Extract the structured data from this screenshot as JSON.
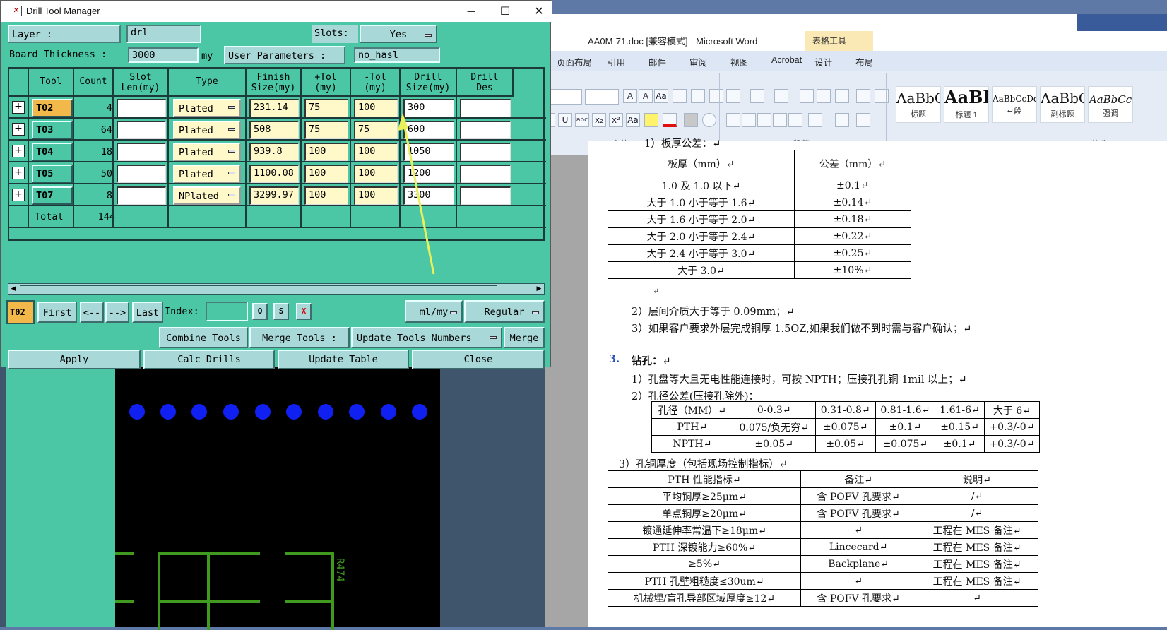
{
  "word": {
    "title": "AA0M-71.doc [兼容模式] - Microsoft Word",
    "table_tools": "表格工具",
    "tabs": [
      "页面布局",
      "引用",
      "邮件",
      "审阅",
      "视图",
      "Acrobat",
      "设计",
      "布局"
    ],
    "group_labels": [
      "字体",
      "段落",
      "样式"
    ],
    "styles": [
      {
        "sample": "AaBbC",
        "name": "标题"
      },
      {
        "sample": "AaBl",
        "name": "标题 1"
      },
      {
        "sample": "AaBbCcDd",
        "name": "↵段"
      },
      {
        "sample": "AaBbC",
        "name": "副标题"
      },
      {
        "sample": "AaBbCc",
        "name": "强调"
      }
    ],
    "ribbon_glyphs": [
      "A",
      "A",
      "Aa",
      "abc",
      "x₂",
      "x²",
      "Aa",
      "U",
      "I"
    ],
    "doc": {
      "heading_cut": "1）板厚公差：↵",
      "thickness_table": {
        "headers": [
          "板厚（mm）↵",
          "公差（mm）↵"
        ],
        "rows": [
          [
            "1.0 及 1.0 以下↵",
            "±0.1↵"
          ],
          [
            "大于 1.0 小于等于 1.6↵",
            "±0.14↵"
          ],
          [
            "大于 1.6 小于等于 2.0↵",
            "±0.18↵"
          ],
          [
            "大于 2.0 小于等于 2.4↵",
            "±0.22↵"
          ],
          [
            "大于 2.4 小于等于 3.0↵",
            "±0.25↵"
          ],
          [
            "大于 3.0↵",
            "±10%↵"
          ]
        ]
      },
      "empty_mark": "↵",
      "item2": "2）层间介质大于等于 0.09mm；↵",
      "item3": "3）如果客户要求外层完成铜厚 1.5OZ,如果我们做不到时需与客户确认；↵",
      "section3_number": "3.",
      "section3_title": "钻孔：↵",
      "drill1": "1）孔盘等大且无电性能连接时，可按 NPTH；压接孔孔铜 1mil 以上；↵",
      "drill2": "2）孔径公差(压接孔除外)：",
      "hole_table": {
        "rows": [
          [
            "孔径（MM）↵",
            "0-0.3↵",
            "0.31-0.8↵",
            "0.81-1.6↵",
            "1.61-6↵",
            "大于 6↵"
          ],
          [
            "PTH↵",
            "0.075/负无穷↵",
            "±0.075↵",
            "±0.1↵",
            "±0.15↵",
            "+0.3/-0↵"
          ],
          [
            "NPTH↵",
            "±0.05↵",
            "±0.05↵",
            "±0.075↵",
            "±0.1↵",
            "+0.3/-0↵"
          ]
        ]
      },
      "drill3": "3）孔铜厚度（包括现场控制指标）↵",
      "copper_table": {
        "rows": [
          [
            "PTH 性能指标↵",
            "备注↵",
            "说明↵"
          ],
          [
            "平均铜厚≥25μm↵",
            "含 POFV 孔要求↵",
            "/↵"
          ],
          [
            "单点铜厚≥20μm↵",
            "含 POFV 孔要求↵",
            "/↵"
          ],
          [
            "镀通延伸率常温下≥18μm↵",
            "↵",
            "工程在 MES 备注↵"
          ],
          [
            "PTH 深镀能力≥60%↵",
            "Lincecard↵",
            "工程在 MES 备注↵"
          ],
          [
            "≥5%↵",
            "Backplane↵",
            "工程在 MES 备注↵"
          ],
          [
            "PTH 孔壁粗糙度≤30um↵",
            "↵",
            "工程在 MES 备注↵"
          ],
          [
            "机械埋/盲孔导部区域厚度≥12↵",
            "含 POFV 孔要求↵",
            "↵"
          ]
        ]
      }
    }
  },
  "cad": {
    "text": "R474"
  },
  "dtm": {
    "title": "Drill Tool Manager",
    "controls": {
      "minimize": "—",
      "maximize": "☐",
      "close": "✕"
    },
    "layer_label": "Layer :",
    "layer_value": "drl",
    "slots_label": "Slots:",
    "slots_value": "Yes",
    "thickness_label": "Board Thickness :",
    "thickness_value": "3000",
    "thickness_unit": "my",
    "user_params_label": "User Parameters :",
    "user_params_value": "no_hasl",
    "columns": [
      {
        "l1": "Tool",
        "l2": ""
      },
      {
        "l1": "Count",
        "l2": ""
      },
      {
        "l1": "Slot",
        "l2": "Len(my)"
      },
      {
        "l1": "Type",
        "l2": ""
      },
      {
        "l1": "Finish",
        "l2": "Size(my)"
      },
      {
        "l1": "+Tol",
        "l2": "(my)"
      },
      {
        "l1": "-Tol",
        "l2": "(my)"
      },
      {
        "l1": "Drill",
        "l2": "Size(my)"
      },
      {
        "l1": "Drill",
        "l2": "Des"
      }
    ],
    "rows": [
      {
        "tool": "T02",
        "count": "4",
        "type": "Plated",
        "finish": "231.14",
        "ptol": "75",
        "ntol": "100",
        "drill": "300",
        "selected": true
      },
      {
        "tool": "T03",
        "count": "64",
        "type": "Plated",
        "finish": "508",
        "ptol": "75",
        "ntol": "75",
        "drill": "600",
        "selected": false
      },
      {
        "tool": "T04",
        "count": "18",
        "type": "Plated",
        "finish": "939.8",
        "ptol": "100",
        "ntol": "100",
        "drill": "1050",
        "selected": false
      },
      {
        "tool": "T05",
        "count": "50",
        "type": "Plated",
        "finish": "1100.08",
        "ptol": "100",
        "ntol": "100",
        "drill": "1200",
        "selected": false
      },
      {
        "tool": "T07",
        "count": "8",
        "type": "NPlated",
        "finish": "3299.97",
        "ptol": "100",
        "ntol": "100",
        "drill": "3300",
        "selected": false
      }
    ],
    "expander": "+",
    "total_label": "Total",
    "total_count": "144",
    "current_tool": "T02",
    "nav": {
      "first": "First",
      "prev": "<--",
      "next": "-->",
      "last": "Last",
      "index_label": "Index:"
    },
    "icons": {
      "q": "Q",
      "s": "S",
      "x": "X"
    },
    "units": "ml/my",
    "mode": "Regular",
    "combine": "Combine Tools",
    "merge_label": "Merge Tools :",
    "update_numbers": "Update Tools Numbers",
    "merge": "Merge",
    "apply": "Apply",
    "calc": "Calc Drills",
    "update_table": "Update Table",
    "close": "Close",
    "colors": {
      "bg": "#4bc7a6",
      "field": "#a8d8d8",
      "yellow": "#fff8c8",
      "selected_tool": "#f2b84a"
    }
  }
}
